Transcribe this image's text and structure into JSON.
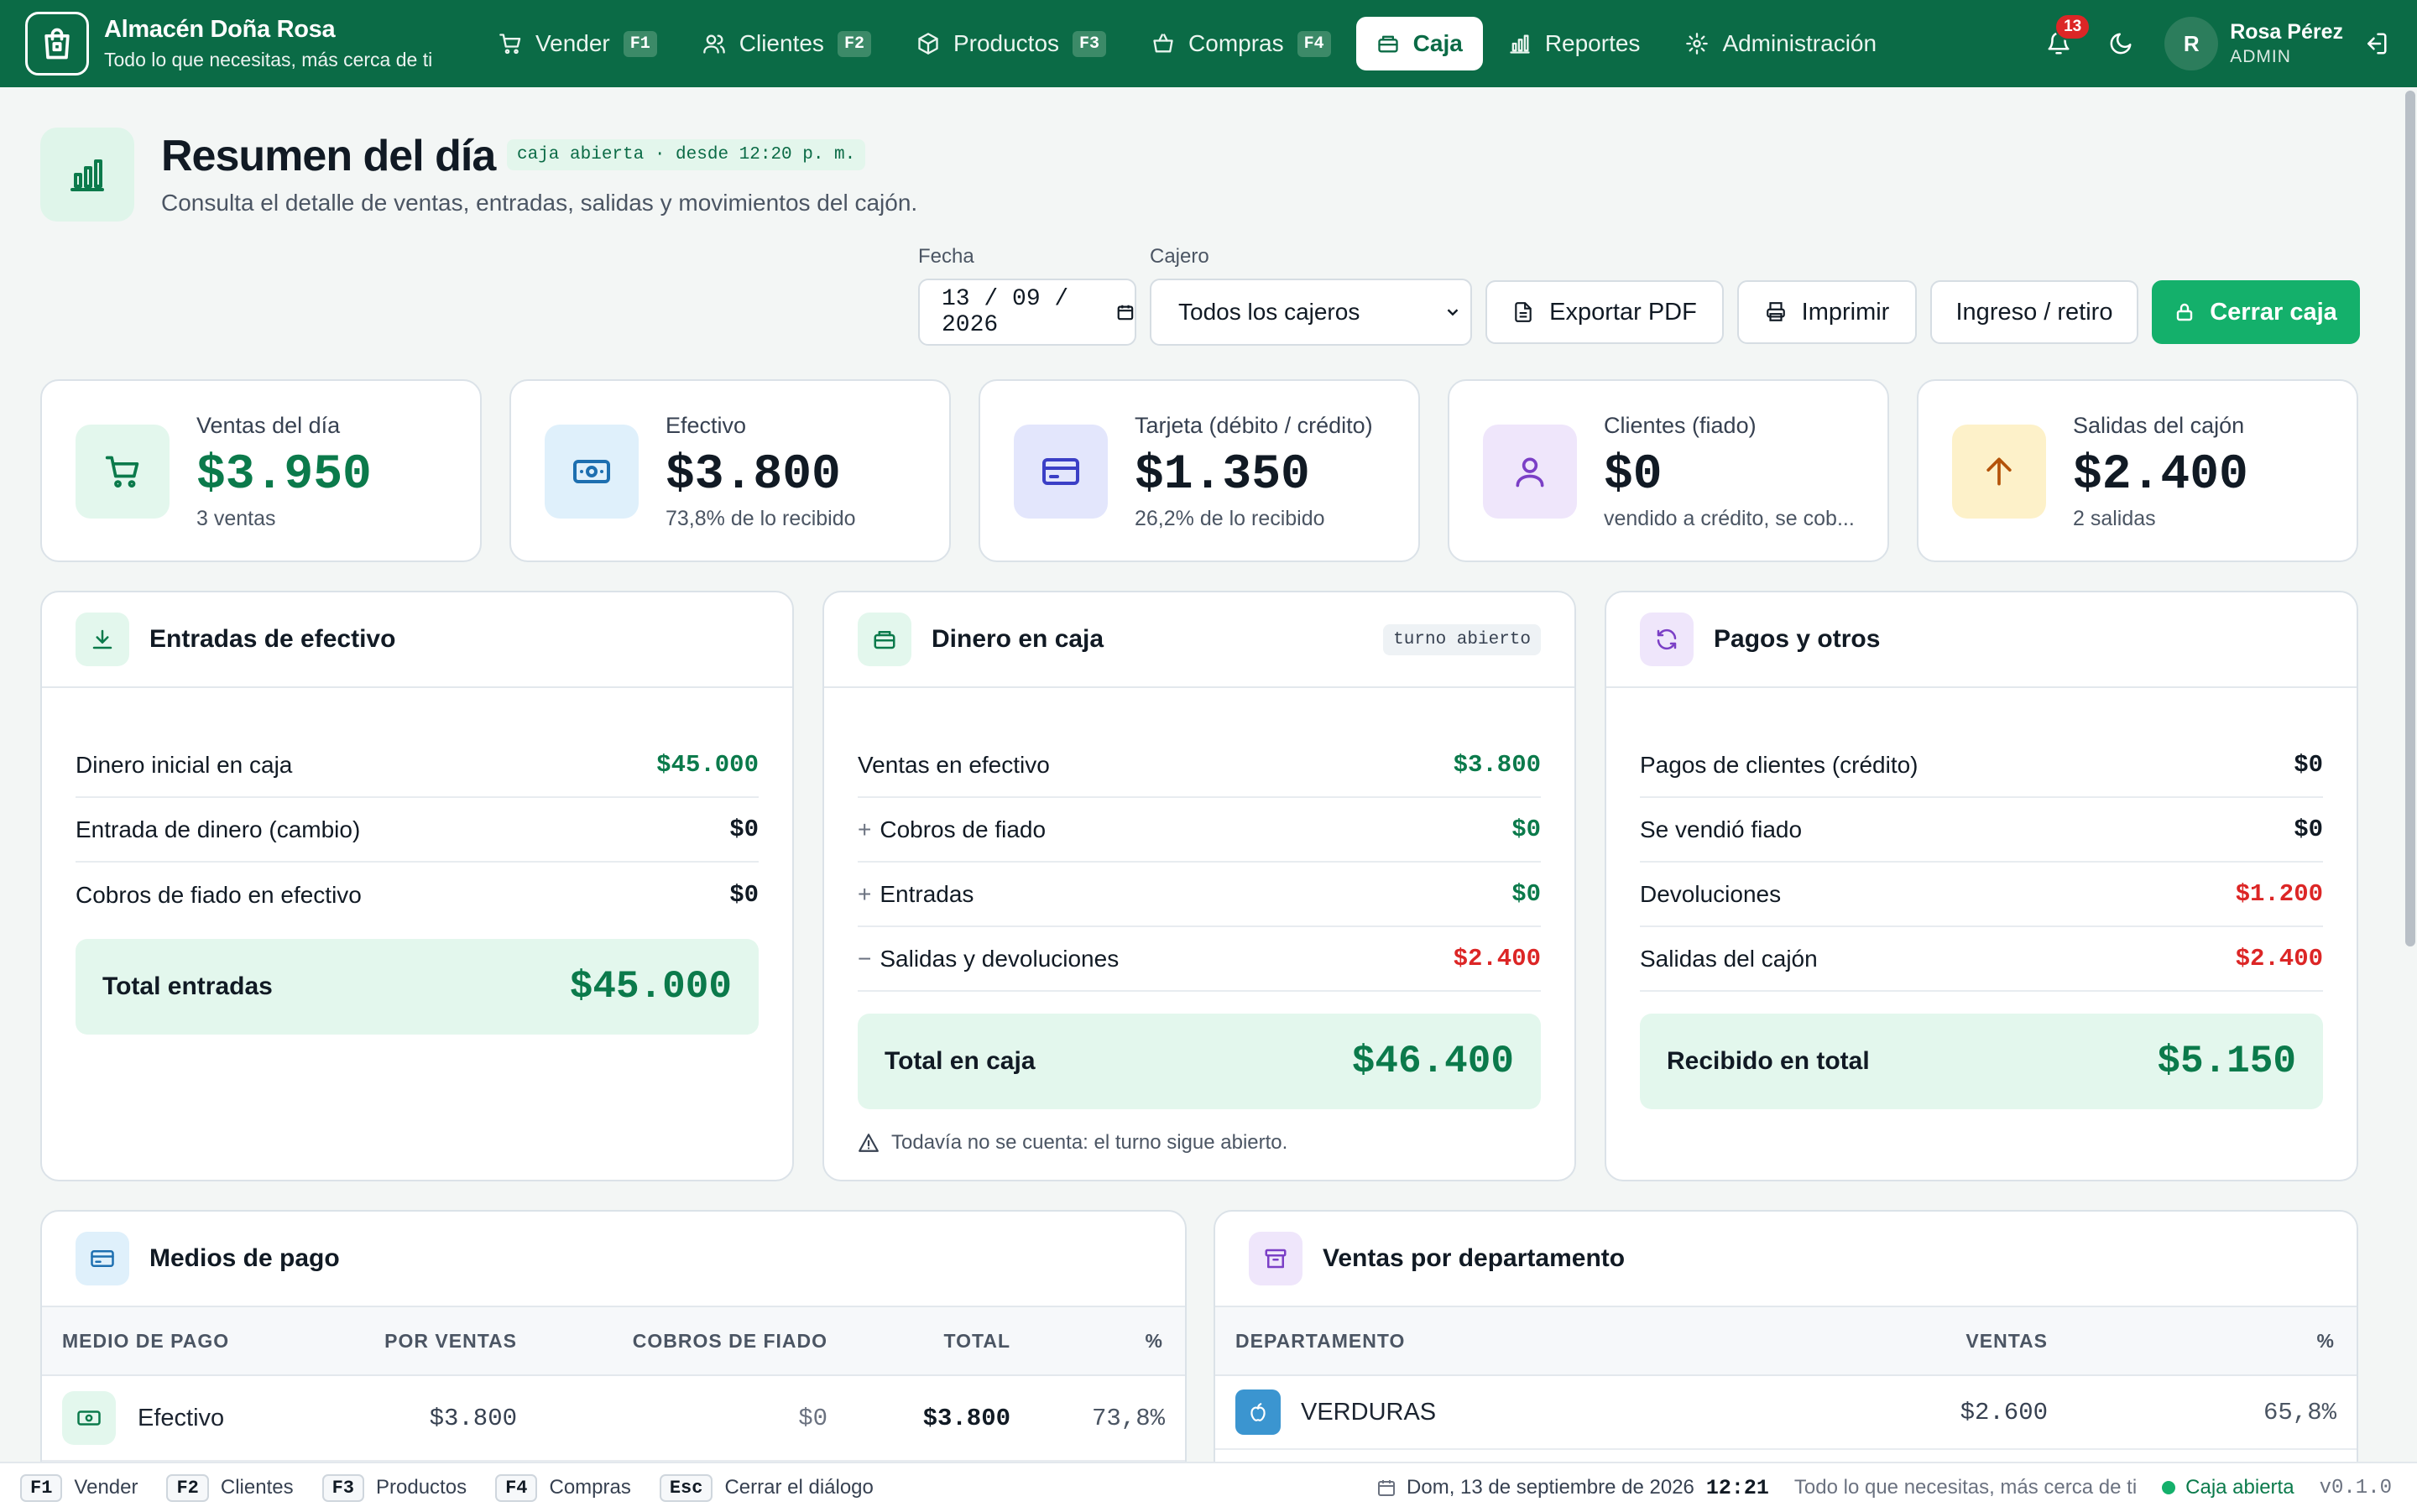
{
  "app": {
    "name": "Almacén Doña Rosa",
    "tagline": "Todo lo que necesitas, más cerca de ti"
  },
  "nav": [
    {
      "label": "Vender",
      "key": "F1"
    },
    {
      "label": "Clientes",
      "key": "F2"
    },
    {
      "label": "Productos",
      "key": "F3"
    },
    {
      "label": "Compras",
      "key": "F4"
    },
    {
      "label": "Caja",
      "key": ""
    },
    {
      "label": "Reportes",
      "key": ""
    },
    {
      "label": "Administración",
      "key": ""
    }
  ],
  "user": {
    "initial": "R",
    "name": "Rosa Pérez",
    "role": "ADMIN",
    "notifications": "13"
  },
  "header": {
    "title": "Resumen del día",
    "status": "caja abierta · desde 12:20 p. m.",
    "subtitle": "Consulta el detalle de ventas, entradas, salidas y movimientos del cajón."
  },
  "filters": {
    "date_label": "Fecha",
    "date_value": "13 / 09 / 2026",
    "cashier_label": "Cajero",
    "cashier_value": "Todos los cajeros",
    "export_pdf": "Exportar PDF",
    "print": "Imprimir",
    "cash_move": "Ingreso / retiro",
    "close_register": "Cerrar caja"
  },
  "stats": [
    {
      "label": "Ventas del día",
      "value": "$3.950",
      "note": "3 ventas"
    },
    {
      "label": "Efectivo",
      "value": "$3.800",
      "note": "73,8% de lo recibido"
    },
    {
      "label": "Tarjeta (débito / crédito)",
      "value": "$1.350",
      "note": "26,2% de lo recibido"
    },
    {
      "label": "Clientes (fiado)",
      "value": "$0",
      "note": "vendido a crédito, se cob..."
    },
    {
      "label": "Salidas del cajón",
      "value": "$2.400",
      "note": "2 salidas"
    }
  ],
  "cash_in": {
    "title": "Entradas de efectivo",
    "rows": [
      {
        "label": "Dinero inicial en caja",
        "value": "$45.000"
      },
      {
        "label": "Entrada de dinero (cambio)",
        "value": "$0"
      },
      {
        "label": "Cobros de fiado en efectivo",
        "value": "$0"
      }
    ],
    "total_label": "Total entradas",
    "total_value": "$45.000"
  },
  "drawer": {
    "title": "Dinero en caja",
    "tag": "turno abierto",
    "rows": [
      {
        "prefix": "",
        "label": "Ventas en efectivo",
        "value": "$3.800"
      },
      {
        "prefix": "+",
        "label": "Cobros de fiado",
        "value": "$0"
      },
      {
        "prefix": "+",
        "label": "Entradas",
        "value": "$0"
      },
      {
        "prefix": "−",
        "label": "Salidas y devoluciones",
        "value": "$2.400"
      }
    ],
    "total_label": "Total en caja",
    "total_value": "$46.400",
    "warning": "Todavía no se cuenta: el turno sigue abierto."
  },
  "payments": {
    "title": "Pagos y otros",
    "rows": [
      {
        "label": "Pagos de clientes (crédito)",
        "value": "$0"
      },
      {
        "label": "Se vendió fiado",
        "value": "$0"
      },
      {
        "label": "Devoluciones",
        "value": "$1.200"
      },
      {
        "label": "Salidas del cajón",
        "value": "$2.400"
      }
    ],
    "total_label": "Recibido en total",
    "total_value": "$5.150"
  },
  "methods": {
    "title": "Medios de pago",
    "columns": [
      "MEDIO DE PAGO",
      "POR VENTAS",
      "COBROS DE FIADO",
      "TOTAL",
      "%"
    ],
    "rows": [
      {
        "method": "Efectivo",
        "sales": "$3.800",
        "credit": "$0",
        "total": "$3.800",
        "pct": "73,8%"
      }
    ]
  },
  "departments": {
    "title": "Ventas por departamento",
    "columns": [
      "DEPARTAMENTO",
      "VENTAS",
      "%"
    ],
    "rows": [
      {
        "name": "VERDURAS",
        "sales": "$2.600",
        "pct": "65,8%"
      }
    ]
  },
  "footer": {
    "shortcuts": [
      {
        "key": "F1",
        "label": "Vender"
      },
      {
        "key": "F2",
        "label": "Clientes"
      },
      {
        "key": "F3",
        "label": "Productos"
      },
      {
        "key": "F4",
        "label": "Compras"
      },
      {
        "key": "Esc",
        "label": "Cerrar el diálogo"
      }
    ],
    "date": "Dom, 13 de septiembre de 2026",
    "time": "12:21",
    "tagline": "Todo lo que necesitas, más cerca de ti",
    "status": "Caja abierta",
    "version": "v0.1.0"
  },
  "colors": {
    "brand": "#0b6b46",
    "accent": "#14b06b",
    "positive": "#0b7a4b",
    "negative": "#dc2626"
  }
}
